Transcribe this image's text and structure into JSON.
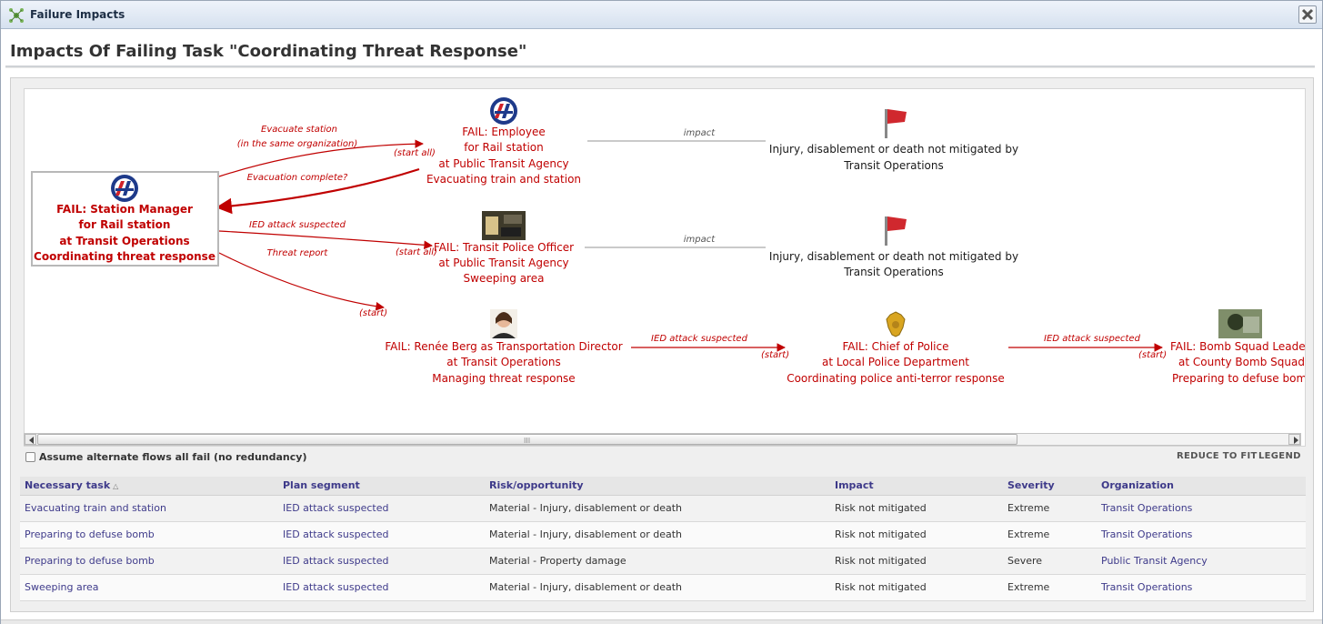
{
  "window": {
    "title": "Failure Impacts"
  },
  "page": {
    "heading": "Impacts Of Failing Task \"Coordinating Threat Response\""
  },
  "graph": {
    "root": {
      "lines": [
        "FAIL: Station Manager",
        "for Rail station",
        "at Transit Operations",
        "Coordinating threat response"
      ]
    },
    "employee": {
      "lines": [
        "FAIL: Employee",
        "for Rail station",
        "at Public Transit Agency",
        "Evacuating train and station"
      ]
    },
    "officer": {
      "lines": [
        "FAIL: Transit Police Officer",
        "at Public Transit Agency",
        "Sweeping area"
      ]
    },
    "director": {
      "lines": [
        "FAIL: Renée Berg as Transportation Director",
        "at Transit Operations",
        "Managing threat response"
      ]
    },
    "chief": {
      "lines": [
        "FAIL: Chief of Police",
        "at Local Police Department",
        "Coordinating police anti-terror response"
      ]
    },
    "bomb_squad": {
      "lines": [
        "FAIL: Bomb Squad Leade",
        "at County Bomb Squad",
        "Preparing to defuse bomb"
      ]
    },
    "impact1": {
      "lines": [
        "Injury, disablement or death not mitigated by",
        "Transit Operations"
      ]
    },
    "impact2": {
      "lines": [
        "Injury, disablement or death not mitigated by",
        "Transit Operations"
      ]
    },
    "edges": {
      "evacuate_1": "Evacuate station",
      "evacuate_2": "(in the same organization)",
      "start_all_1": "(start all)",
      "evacuation_complete": "Evacuation complete?",
      "ied_1": "IED attack suspected",
      "start_all_2": "(start all)",
      "threat_report": "Threat report",
      "start_1": "(start)",
      "ied_2": "IED attack suspected",
      "start_2": "(start)",
      "ied_3": "IED attack suspected",
      "start_3": "(start)",
      "impact_a": "impact",
      "impact_b": "impact"
    },
    "colors": {
      "fail": "#c00000",
      "impact_line": "#aaaaaa",
      "flag": "#d0282e"
    }
  },
  "scrollbar": {
    "grip": "III"
  },
  "options": {
    "assume_fail_label": "Assume alternate flows all fail (no redundancy)",
    "assume_fail_checked": false
  },
  "toolbar": {
    "reduce_to_fit": "REDUCE TO FIT",
    "legend": "LEGEND"
  },
  "table": {
    "columns": [
      "Necessary task",
      "Plan segment",
      "Risk/opportunity",
      "Impact",
      "Severity",
      "Organization"
    ],
    "sort_indicator": "△",
    "rows": [
      {
        "task": "Evacuating train and station",
        "segment": "IED attack suspected",
        "risk": "Material - Injury, disablement or death",
        "impact": "Risk not mitigated",
        "severity": "Extreme",
        "org": "Transit Operations"
      },
      {
        "task": "Preparing to defuse bomb",
        "segment": "IED attack suspected",
        "risk": "Material - Injury, disablement or death",
        "impact": "Risk not mitigated",
        "severity": "Extreme",
        "org": "Transit Operations"
      },
      {
        "task": "Preparing to defuse bomb",
        "segment": "IED attack suspected",
        "risk": "Material - Property damage",
        "impact": "Risk not mitigated",
        "severity": "Severe",
        "org": "Public Transit Agency"
      },
      {
        "task": "Sweeping area",
        "segment": "IED attack suspected",
        "risk": "Material - Injury, disablement or death",
        "impact": "Risk not mitigated",
        "severity": "Extreme",
        "org": "Transit Operations"
      }
    ]
  }
}
